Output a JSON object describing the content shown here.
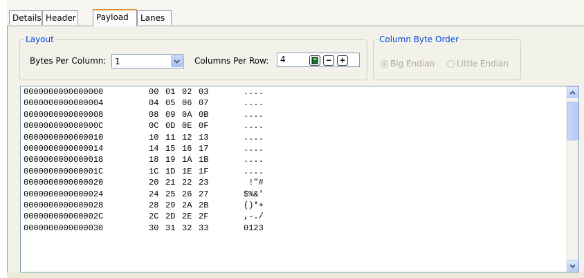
{
  "tabs": [
    {
      "label": "Details"
    },
    {
      "label": "Header"
    },
    {
      "label": "Payload"
    },
    {
      "label": "Lanes"
    }
  ],
  "layout": {
    "legend": "Layout",
    "bytes_per_column_label": "Bytes Per Column:",
    "bytes_per_column_value": "1",
    "columns_per_row_label": "Columns Per Row:",
    "columns_per_row_value": "4",
    "minus_label": "−",
    "plus_label": "+"
  },
  "byte_order": {
    "legend": "Column Byte Order",
    "options": [
      {
        "label": "Big Endian",
        "selected": true
      },
      {
        "label": "Little Endian",
        "selected": false
      }
    ]
  },
  "hex_rows": [
    {
      "addr": "0000000000000000",
      "bytes": [
        "00",
        "01",
        "02",
        "03"
      ],
      "ascii": "...."
    },
    {
      "addr": "0000000000000004",
      "bytes": [
        "04",
        "05",
        "06",
        "07"
      ],
      "ascii": "...."
    },
    {
      "addr": "0000000000000008",
      "bytes": [
        "08",
        "09",
        "0A",
        "0B"
      ],
      "ascii": "...."
    },
    {
      "addr": "000000000000000C",
      "bytes": [
        "0C",
        "0D",
        "0E",
        "0F"
      ],
      "ascii": "...."
    },
    {
      "addr": "0000000000000010",
      "bytes": [
        "10",
        "11",
        "12",
        "13"
      ],
      "ascii": "...."
    },
    {
      "addr": "0000000000000014",
      "bytes": [
        "14",
        "15",
        "16",
        "17"
      ],
      "ascii": "...."
    },
    {
      "addr": "0000000000000018",
      "bytes": [
        "18",
        "19",
        "1A",
        "1B"
      ],
      "ascii": "...."
    },
    {
      "addr": "000000000000001C",
      "bytes": [
        "1C",
        "1D",
        "1E",
        "1F"
      ],
      "ascii": "...."
    },
    {
      "addr": "0000000000000020",
      "bytes": [
        "20",
        "21",
        "22",
        "23"
      ],
      "ascii": " !\"#"
    },
    {
      "addr": "0000000000000024",
      "bytes": [
        "24",
        "25",
        "26",
        "27"
      ],
      "ascii": "$%&'"
    },
    {
      "addr": "0000000000000028",
      "bytes": [
        "28",
        "29",
        "2A",
        "2B"
      ],
      "ascii": "()*+"
    },
    {
      "addr": "000000000000002C",
      "bytes": [
        "2C",
        "2D",
        "2E",
        "2F"
      ],
      "ascii": ",-./"
    },
    {
      "addr": "0000000000000030",
      "bytes": [
        "30",
        "31",
        "32",
        "33"
      ],
      "ascii": "0123"
    }
  ],
  "scrollbar": {
    "up_icon": "scroll-up-arrow-icon",
    "down_icon": "scroll-down-arrow-icon"
  },
  "colors": {
    "accent_tab": "#e68b2c",
    "legend_text": "#0046d5",
    "panel_bg": "#f2f1ea"
  }
}
